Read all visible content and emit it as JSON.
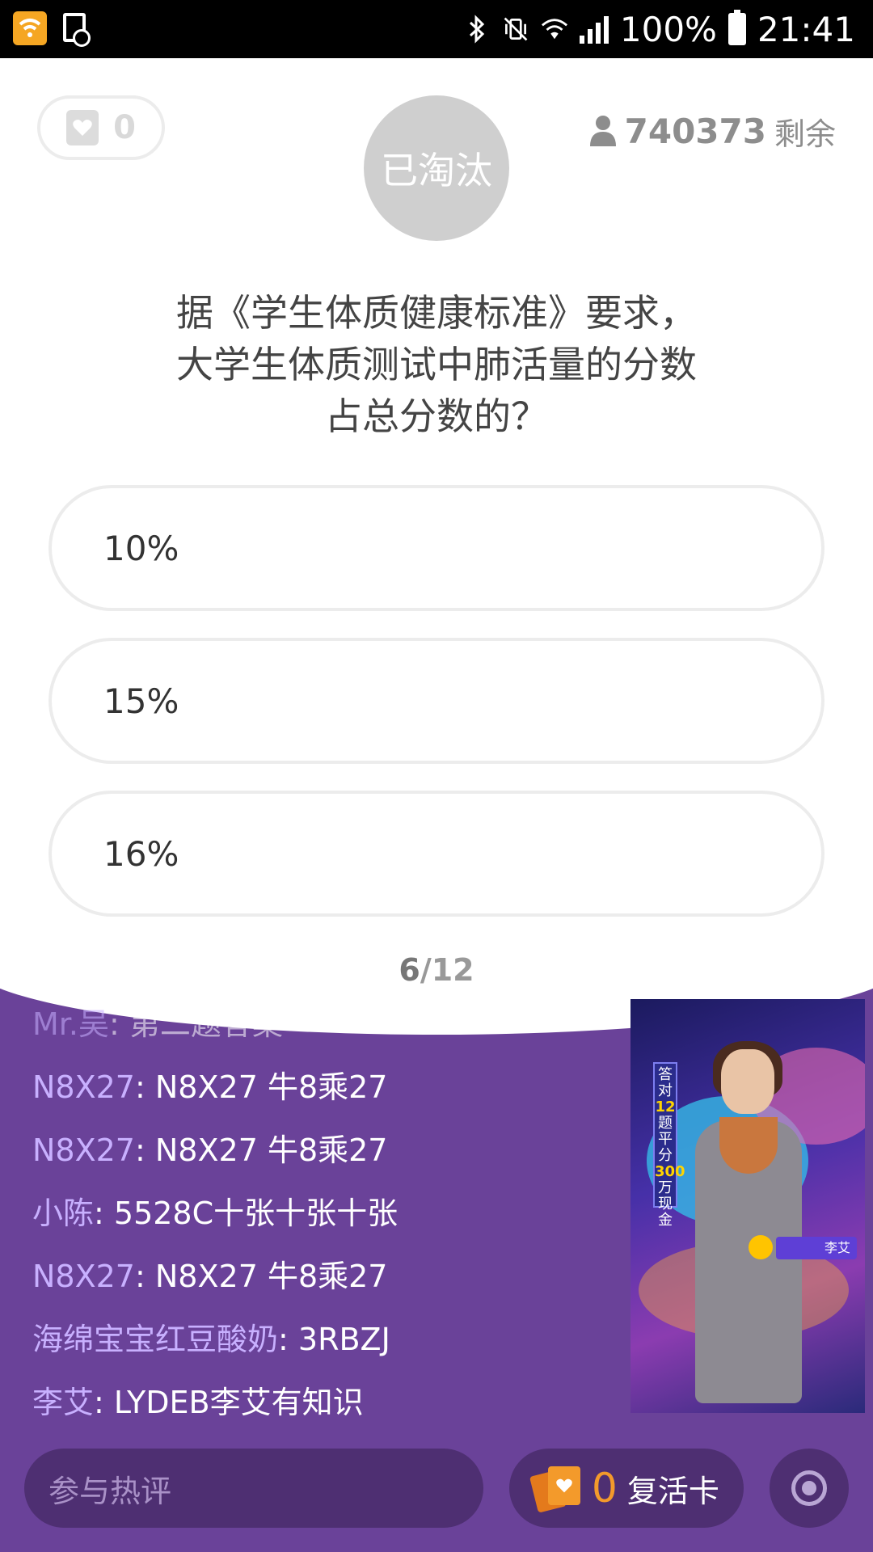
{
  "status_bar": {
    "battery": "100%",
    "time": "21:41"
  },
  "top": {
    "lives_count": "0",
    "status": "已淘汰",
    "remaining_count": "740373",
    "remaining_suffix": "剩余"
  },
  "question": {
    "text": "据《学生体质健康标准》要求，大学生体质测试中肺活量的分数占总分数的？",
    "options": [
      "10%",
      "15%",
      "16%"
    ],
    "progress_current": "6",
    "progress_total": "/12"
  },
  "chat": [
    {
      "user": "Mr.吴",
      "msg": ": 第二题答案"
    },
    {
      "user": "N8X27",
      "msg": ": N8X27 牛8乘27"
    },
    {
      "user": "N8X27",
      "msg": ": N8X27 牛8乘27"
    },
    {
      "user": "小陈",
      "msg": ": 5528C十张十张十张"
    },
    {
      "user": "N8X27",
      "msg": ": N8X27 牛8乘27"
    },
    {
      "user": "海绵宝宝红豆酸奶",
      "msg": ": 3RBZJ"
    },
    {
      "user": "李艾",
      "msg": ": LYDEB李艾有知识"
    }
  ],
  "video": {
    "banner_a": "答对",
    "banner_num": "12",
    "banner_b": "题平分",
    "banner_amount": "300",
    "banner_c": "万现金",
    "host_tag": "李艾"
  },
  "bottom": {
    "comment_placeholder": "参与热评",
    "revive_count": "0",
    "revive_label": "复活卡"
  },
  "colors": {
    "accent_purple": "#6a4299",
    "revive_orange": "#f39a2b"
  }
}
